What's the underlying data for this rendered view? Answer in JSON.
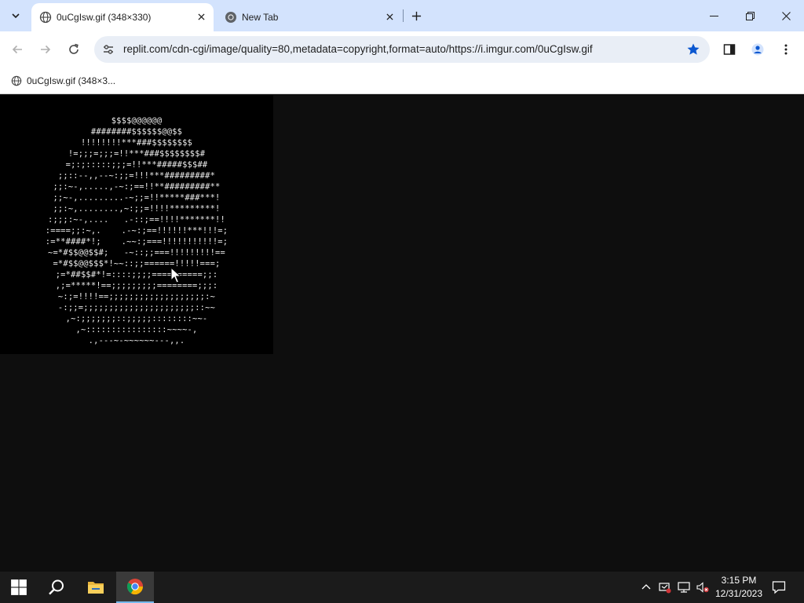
{
  "browser": {
    "tabs": [
      {
        "title": "0uCgIsw.gif (348×330)",
        "active": true,
        "favicon": "globe-icon"
      },
      {
        "title": "New Tab",
        "active": false,
        "favicon": "chrome-icon"
      }
    ],
    "url": "replit.com/cdn-cgi/image/quality=80,metadata=copyright,format=auto/https://i.imgur.com/0uCgIsw.gif",
    "bookmarks": [
      {
        "label": "0uCgIsw.gif (348×3...",
        "icon": "globe-icon"
      }
    ],
    "colors": {
      "tabstrip": "#d3e3fd",
      "omnibox": "#e9eef6",
      "accent": "#0b57d0",
      "page_bg": "#0e0e0e"
    }
  },
  "page": {
    "ascii_art": [
      "$$$$@@@@@@",
      "########$$$$$$@@$$",
      "!!!!!!!!***###$$$$$$$$",
      "!=;;;=;;;=!!***###$$$$$$$$#",
      "=;:;:::::;;;=!!***#####$$$##",
      ";;::--,,--~:;;=!!!***#########*",
      ";;:~-,.....,-~:;==!!**#########**",
      ";;~-,.........-~;;=!!*****###***!",
      ";;:~,........,~:;;=!!!!*********!",
      ":;;;:~-,....   .-::;==!!!!*******!!",
      ":====;;:~,.    .-~:;==!!!!!!***!!!=;",
      ":=**####*!;    .~~:;===!!!!!!!!!!!=;",
      "~=*#$$@@$$#;   -~::;;===!!!!!!!!!==",
      "=*#$$@@$$$*!~~::;;======!!!!!===;",
      ";=*##$$#*!=::::;;;;==========;;:",
      ",;=*****!==;;;;;;;;;========;;;:",
      "~:;=!!!!==;;;;;;;;;;;;;;;;;;;:~",
      "-:;;=;;;;;;;;;;;;;;;;;;;;;;::~~",
      ",~:;;;;;;;::;;;;;::::::::~~-",
      ",~::::::::::::::::~~~~-,",
      ".,---~-~~~~~~---,,."
    ]
  },
  "taskbar": {
    "apps": [
      {
        "name": "Start",
        "icon": "windows-icon"
      },
      {
        "name": "Search",
        "icon": "search-icon"
      },
      {
        "name": "File Explorer",
        "icon": "folder-icon"
      },
      {
        "name": "Google Chrome",
        "icon": "chrome-icon",
        "active": true
      }
    ],
    "time": "3:15 PM",
    "date": "12/31/2023"
  }
}
